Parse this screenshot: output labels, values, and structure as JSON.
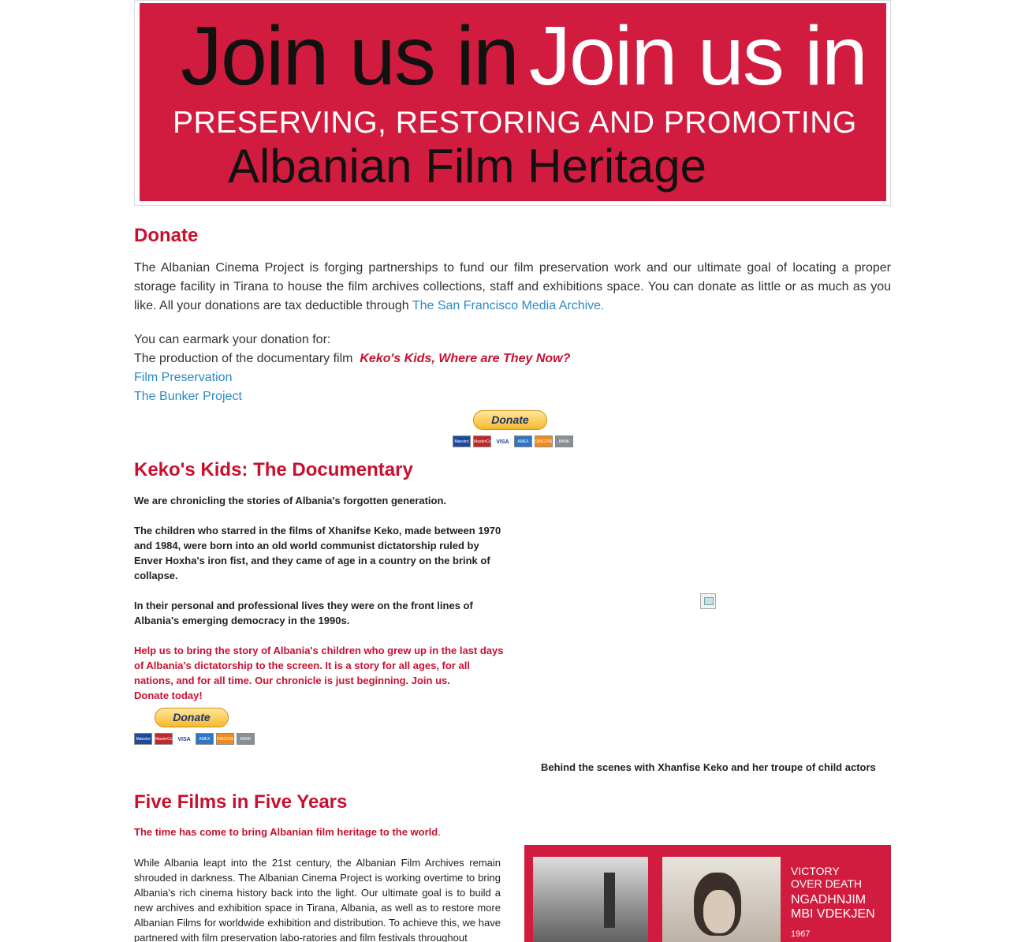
{
  "banner": {
    "join_text": "Join us in",
    "tagline": "PRESERVING, RESTORING AND PROMOTING",
    "heritage": "Albanian Film Heritage"
  },
  "donate": {
    "heading": "Donate",
    "intro": "The Albanian Cinema Project is forging partnerships to fund our film preservation work and our ultimate goal of locating a proper storage facility in Tirana to house the film archives collections, staff and exhibitions space. You can donate as little or as much as you like.  All your donations are tax deductible through ",
    "intro_link": "The San Francisco Media Archive.",
    "earmark_label": "You can earmark your donation for:",
    "production_text": "The production of the documentary film ",
    "production_film": "Keko's Kids, Where are They Now?",
    "link_film_preservation": "Film Preservation",
    "link_bunker": "The Bunker Project"
  },
  "paypal": {
    "button_label": "Donate",
    "cards": [
      "Maestro",
      "MasterCard",
      "VISA",
      "AMEX",
      "DISCOVER",
      "BANK"
    ],
    "card_colors": [
      "#1b4aa0",
      "#c0282d",
      "#ffffff",
      "#2d76c0",
      "#f08a1e",
      "#8a8f96"
    ]
  },
  "kekos": {
    "heading": "Keko's Kids: The Documentary",
    "p1": " We are chronicling the stories of Albania's forgotten generation.",
    "p2": "The children who starred in the films of  Xhanifse Keko, made between 1970 and 1984, were born into an old world communist dictatorship ruled by Enver Hoxha's iron fist, and they came of age in a country on the brink of collapse.",
    "p3": "In their personal and professional  lives they were on the front lines of Albania's emerging democracy in the 1990s.",
    "p4": "Help us to bring the story of Albania's children who grew up in the last days of Albania's dictatorship to the screen. It is a story for all ages, for all nations, and for all time. Our chronicle is just beginning. Join us.",
    "p5": "Donate today!",
    "caption": "Behind the scenes with Xhanfise Keko and her troupe of child actors"
  },
  "five": {
    "heading": "Five Films in Five Years",
    "lead": "The time has come to bring Albanian film heritage to the world",
    "body": "While Albania leapt into the 21st century, the Albanian Film Archives remain shrouded in darkness. The Albanian Cinema Project is working overtime to bring Albania's rich cinema history back into the light. Our ultimate goal is to build a new archives and exhibition space in Tirana, Albania, as well as to restore more Albanian Films for worldwide exhibition and distribution.  To achieve this, we have partnered with film preservation labo-ratories and film festivals throughout",
    "poster_line1": "VICTORY",
    "poster_line2": "OVER DEATH",
    "poster_line3": "NGADHNJIM",
    "poster_line4": "MBI VDEKJEN",
    "poster_year": "1967"
  }
}
